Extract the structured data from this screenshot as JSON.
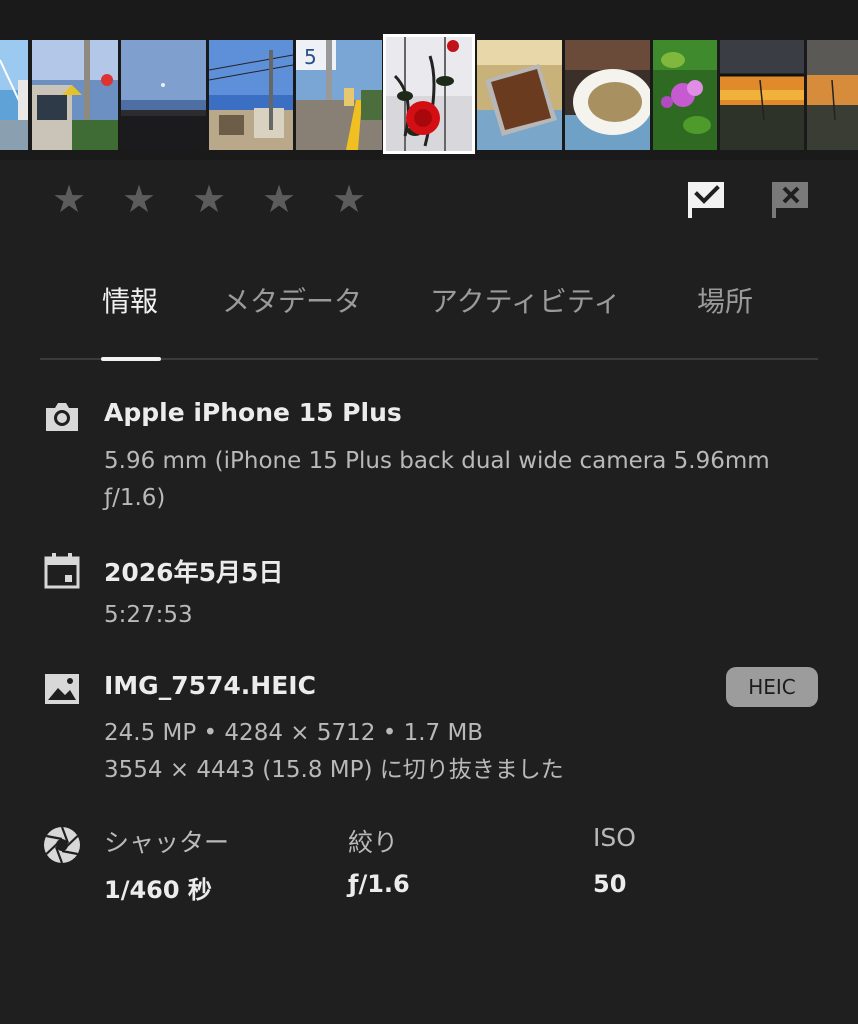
{
  "filmstrip": {
    "thumbnails": [
      {
        "name": "thumb-street-sky",
        "selected": false
      },
      {
        "name": "thumb-house-pole",
        "selected": false
      },
      {
        "name": "thumb-dusk-sky-roof",
        "selected": false
      },
      {
        "name": "thumb-town-wires",
        "selected": false
      },
      {
        "name": "thumb-road-sign",
        "selected": false
      },
      {
        "name": "thumb-red-rose",
        "selected": true
      },
      {
        "name": "thumb-coffee-beans-tray",
        "selected": false
      },
      {
        "name": "thumb-coffee-beans-bowl",
        "selected": false
      },
      {
        "name": "thumb-purple-flower",
        "selected": false
      },
      {
        "name": "thumb-sunset-window",
        "selected": false
      },
      {
        "name": "thumb-sunset-city",
        "selected": false
      }
    ]
  },
  "rating": {
    "stars": [
      "★",
      "★",
      "★",
      "★",
      "★"
    ],
    "value": 0,
    "star_color": "#5c5c5c"
  },
  "flags": {
    "pick_icon": "flag-check-icon",
    "reject_icon": "flag-x-icon"
  },
  "tabs": [
    {
      "label": "情報",
      "active": true
    },
    {
      "label": "メタデータ",
      "active": false
    },
    {
      "label": "アクティビティ",
      "active": false
    },
    {
      "label": "場所",
      "active": false
    }
  ],
  "camera": {
    "icon": "camera-icon",
    "model": "Apple iPhone 15 Plus",
    "lens_line1": "5.96 mm (iPhone 15 Plus back dual wide camera 5.96mm",
    "lens_line2": "ƒ/1.6)"
  },
  "date": {
    "icon": "calendar-icon",
    "date": "2026年5月5日",
    "time": "5:27:53"
  },
  "file": {
    "icon": "image-icon",
    "name": "IMG_7574.HEIC",
    "badge": "HEIC",
    "details": "24.5 MP • 4284 × 5712 • 1.7 MB",
    "crop": "3554 × 4443 (15.8 MP) に切り抜きました"
  },
  "exposure": {
    "icon": "aperture-icon",
    "shutter_label": "シャッター",
    "shutter_value": "1/460 秒",
    "aperture_label": "絞り",
    "aperture_value": "ƒ/1.6",
    "iso_label": "ISO",
    "iso_value": "50"
  },
  "colors": {
    "background": "#1f1f1f",
    "accent_white": "#ffffff",
    "badge_bg": "#9c9c9c"
  }
}
